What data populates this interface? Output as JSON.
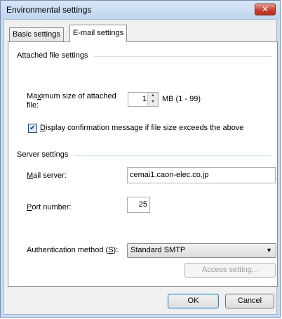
{
  "window": {
    "title": "Environmental settings",
    "close_glyph": "✕"
  },
  "tabs": [
    {
      "label": "Basic settings",
      "active": false
    },
    {
      "label": "E-mail settings",
      "active": true
    }
  ],
  "attached": {
    "section_label": "Attached file settings",
    "max_size_label_mnemonic": "Ma",
    "max_size_label_underlined": "x",
    "max_size_label_rest": "imum size of attached",
    "max_size_label_line2": "file:",
    "max_size_value": "1",
    "size_unit": "MB (1 - 99)",
    "confirm_checked": true,
    "confirm_mnemonic": "D",
    "confirm_rest": "isplay confirmation message if file size exceeds the above"
  },
  "server": {
    "section_label": "Server settings",
    "mail_server_mnemonic": "M",
    "mail_server_rest": "ail server:",
    "mail_server_value": "cemai1.caon-elec.co.jp",
    "port_mnemonic": "P",
    "port_rest": "ort number:",
    "port_value": "25",
    "auth_prefix": "Authentication method (",
    "auth_mnemonic": "S",
    "auth_suffix": "):",
    "auth_value": "Standard SMTP",
    "access_button": "Access setting..."
  },
  "footer": {
    "ok": "OK",
    "cancel": "Cancel"
  },
  "icons": {
    "check": "✔",
    "up": "▲",
    "down": "▼",
    "dropdown_arrow": "▼"
  },
  "colors": {
    "accent": "#3c7fb1",
    "title_bar": "#c7dcf2",
    "close": "#c8432f"
  }
}
